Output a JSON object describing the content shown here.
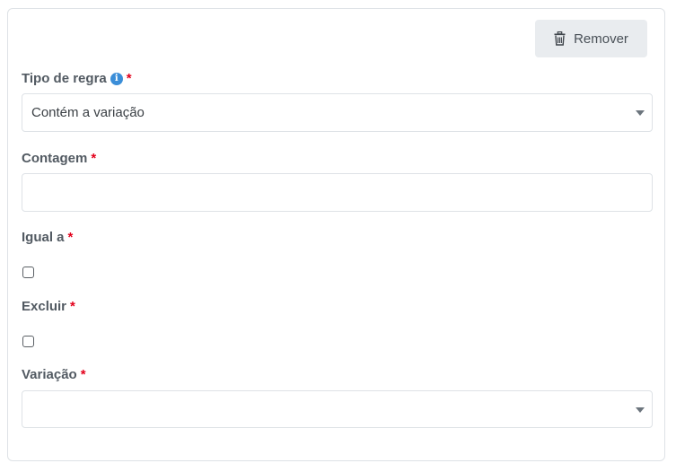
{
  "actions": {
    "remove_label": "Remover",
    "remove_icon": "trash-icon"
  },
  "fields": {
    "tipo_de_regra": {
      "label": "Tipo de regra",
      "required_mark": "*",
      "info_icon": "info-icon",
      "info_glyph": "i",
      "value": "Contém a variação"
    },
    "contagem": {
      "label": "Contagem",
      "required_mark": "*",
      "value": ""
    },
    "igual_a": {
      "label": "Igual a",
      "required_mark": "*",
      "checked": false
    },
    "excluir": {
      "label": "Excluir",
      "required_mark": "*",
      "checked": false
    },
    "variacao": {
      "label": "Variação",
      "required_mark": "*",
      "value": ""
    }
  },
  "colors": {
    "required": "#e3001b",
    "info": "#3b8ed8",
    "button_bg": "#e9ecef",
    "border": "#dee2e6"
  }
}
